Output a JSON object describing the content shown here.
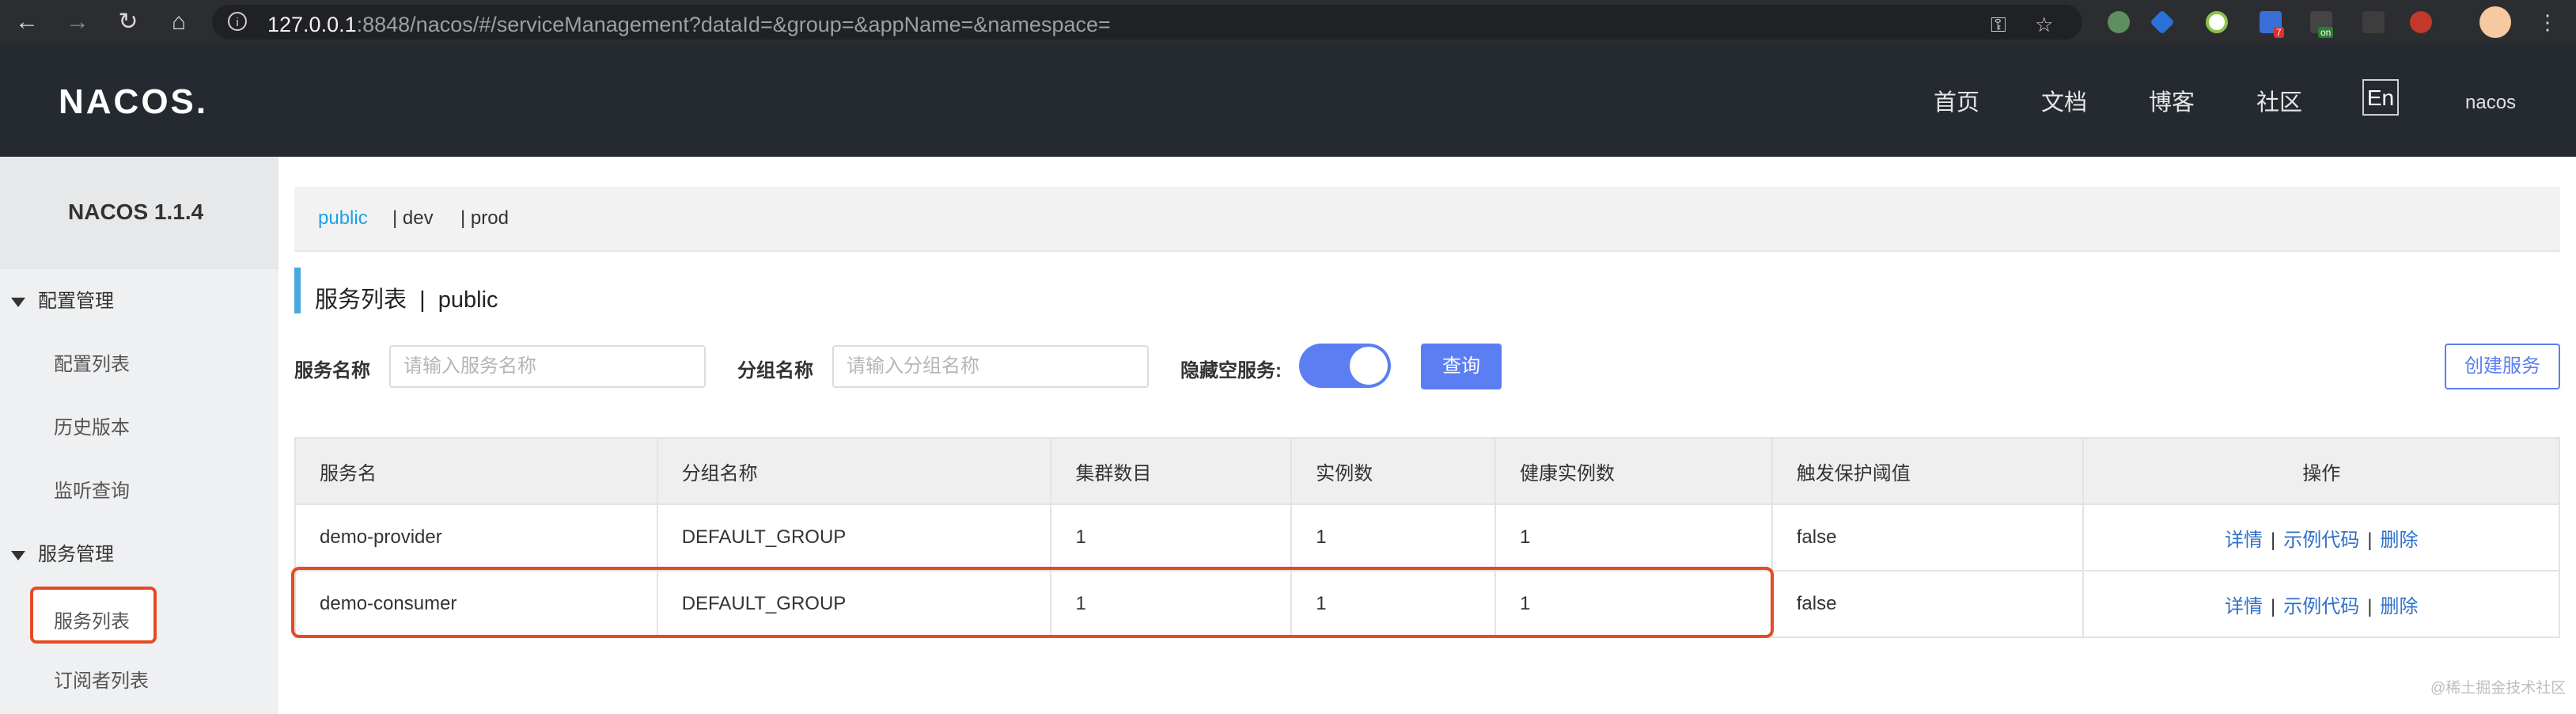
{
  "browser": {
    "url_host": "127.0.0.1",
    "url_rest": ":8848/nacos/#/serviceManagement?dataId=&group=&appName=&namespace=",
    "ext_badge_1": "7",
    "ext_badge_2": "on"
  },
  "header": {
    "logo": "NACOS.",
    "nav": [
      "首页",
      "文档",
      "博客",
      "社区"
    ],
    "lang": "En",
    "user": "nacos"
  },
  "sidebar": {
    "version": "NACOS 1.1.4",
    "groups": [
      {
        "label": "配置管理",
        "items": [
          "配置列表",
          "历史版本",
          "监听查询"
        ]
      },
      {
        "label": "服务管理",
        "items": [
          "服务列表",
          "订阅者列表"
        ]
      }
    ]
  },
  "namespaces": {
    "tabs": [
      "public",
      "| dev",
      "| prod"
    ]
  },
  "page": {
    "title": "服务列表  |  public"
  },
  "filters": {
    "service_label": "服务名称",
    "service_placeholder": "请输入服务名称",
    "group_label": "分组名称",
    "group_placeholder": "请输入分组名称",
    "hide_empty_label": "隐藏空服务:",
    "hide_empty": true,
    "query_button": "查询",
    "create_button": "创建服务"
  },
  "table": {
    "headers": [
      "服务名",
      "分组名称",
      "集群数目",
      "实例数",
      "健康实例数",
      "触发保护阈值",
      "操作"
    ],
    "rows": [
      [
        "demo-provider",
        "DEFAULT_GROUP",
        "1",
        "1",
        "1",
        "false"
      ],
      [
        "demo-consumer",
        "DEFAULT_GROUP",
        "1",
        "1",
        "1",
        "false"
      ]
    ],
    "actions": [
      "详情",
      "示例代码",
      "删除"
    ],
    "separator": "|"
  },
  "watermark": "@稀土掘金技术社区",
  "colors": {
    "primary": "#5b7ef2",
    "header_bg": "#252a31",
    "highlight": "#e44b23",
    "active_tab": "#1ea1e8"
  }
}
